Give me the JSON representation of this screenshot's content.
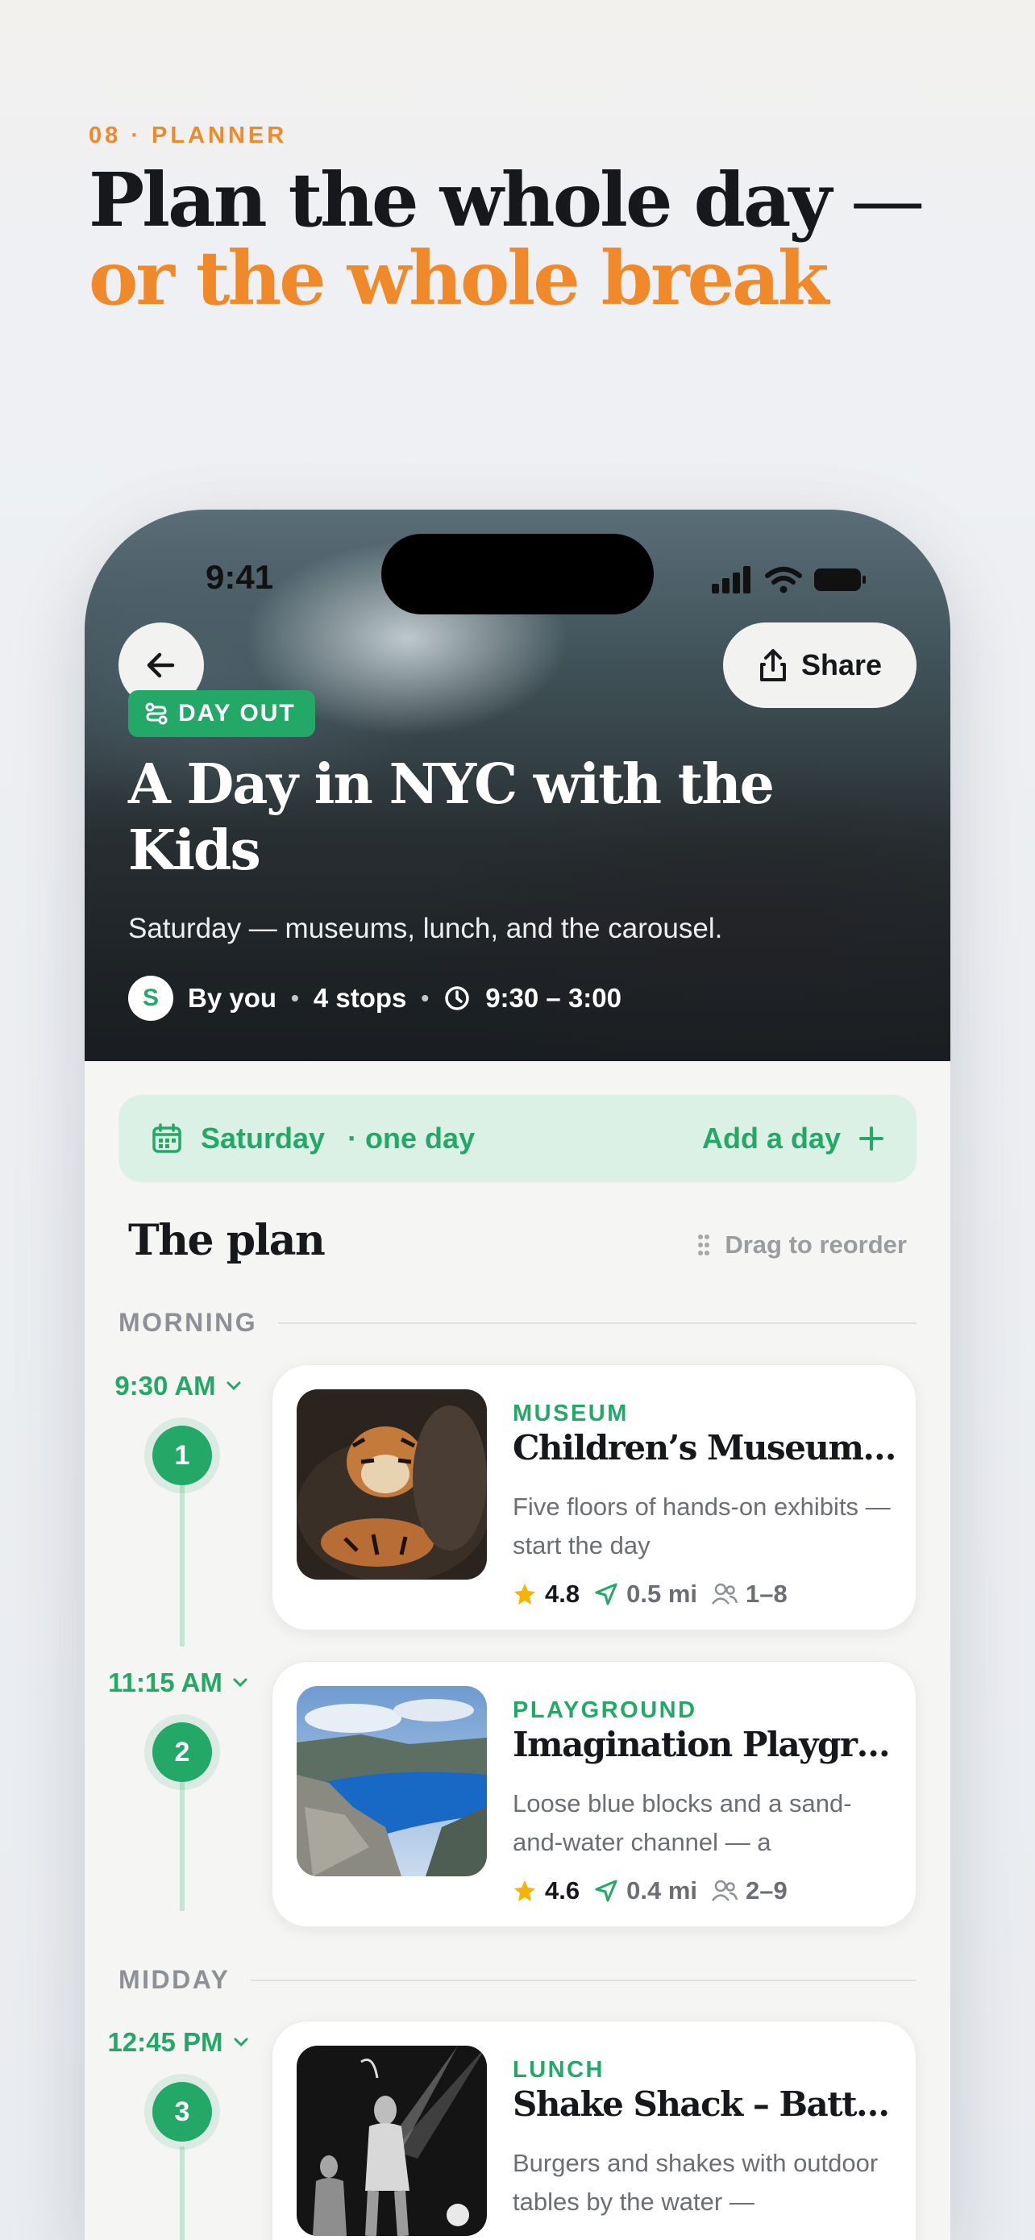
{
  "page": {
    "eyebrow": "08 · PLANNER",
    "headline_main": "Plan the whole day",
    "headline_dash": " — ",
    "headline_accent": "or the whole break"
  },
  "status_bar": {
    "time": "9:41"
  },
  "hero": {
    "share_label": "Share",
    "tag": "DAY OUT",
    "title": "A Day in NYC with the Kids",
    "subtitle": "Saturday — museums, lunch, and the carousel.",
    "avatar_initial": "S",
    "author": "By you",
    "stops": "4 stops",
    "time_range": "9:30 – 3:00"
  },
  "day_bar": {
    "day": "Saturday",
    "duration": "· one day",
    "add_label": "Add a day"
  },
  "plan": {
    "title": "The plan",
    "drag_hint": "Drag to reorder",
    "sections": [
      "MORNING",
      "MIDDAY"
    ],
    "stops": [
      {
        "time": "9:30 AM",
        "number": "1",
        "category": "MUSEUM",
        "name": "Children’s Museum of …",
        "desc": "Five floors of hands-on exhibits — start the day",
        "rating": "4.8",
        "distance": "0.5 mi",
        "ages": "1–8"
      },
      {
        "time": "11:15 AM",
        "number": "2",
        "category": "PLAYGROUND",
        "name": "Imagination Playground",
        "desc": "Loose blue blocks and a sand-and-water channel — a",
        "rating": "4.6",
        "distance": "0.4 mi",
        "ages": "2–9"
      },
      {
        "time": "12:45 PM",
        "number": "3",
        "category": "LUNCH",
        "name": "Shake Shack – Battery…",
        "desc": "Burgers and shakes with outdoor tables by the water —",
        "rating": "",
        "distance": "",
        "ages": ""
      }
    ]
  },
  "colors": {
    "accent_orange": "#f0892a",
    "brand_green": "#23a867",
    "mint_bg": "#dcf1e5"
  }
}
